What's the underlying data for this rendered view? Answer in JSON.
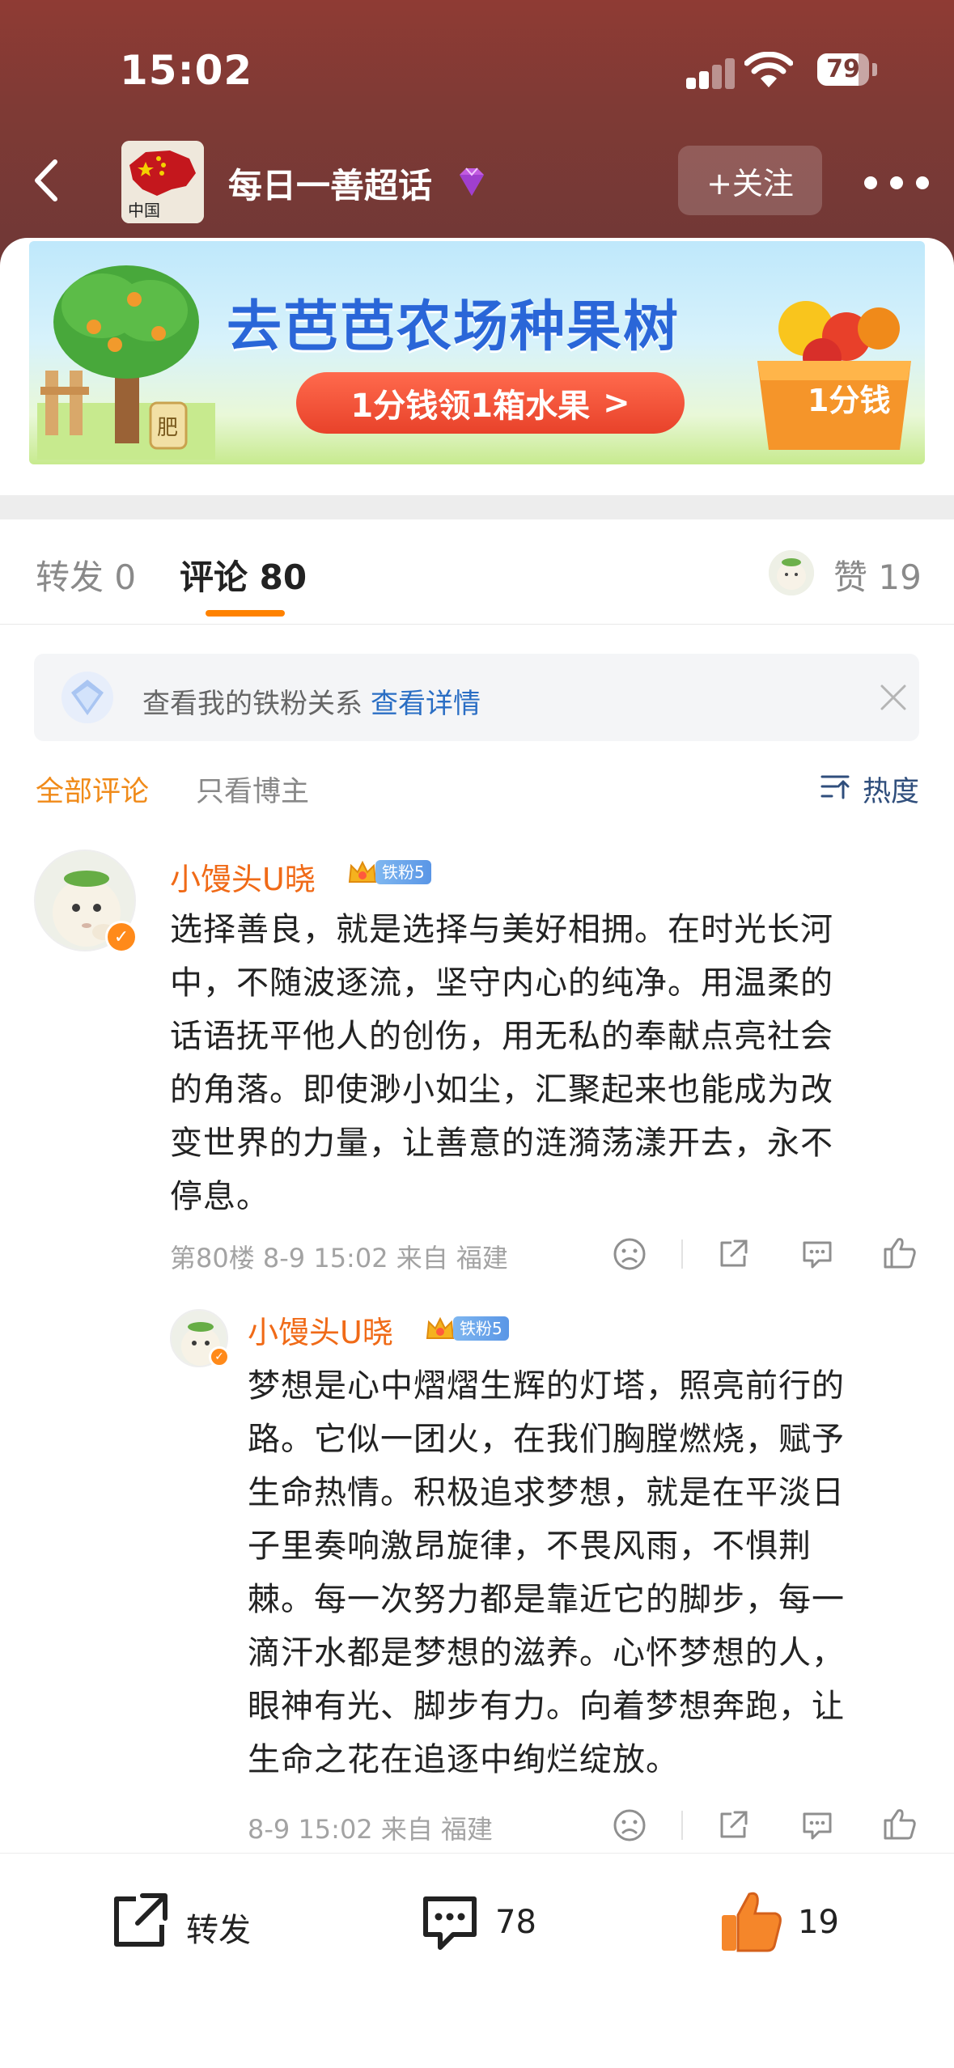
{
  "status_bar": {
    "time": "15:02",
    "battery": "79",
    "battery_fraction": 0.79
  },
  "header": {
    "topic_title": "每日一善超话",
    "follow_label": "+关注",
    "thumb_text": "中国"
  },
  "banner": {
    "title": "去芭芭农场种果树",
    "pill_label": "1分钱领1箱水果",
    "pill_arrow": ">",
    "basket_label": "1分钱",
    "tree_tag": "肥"
  },
  "tabs": {
    "forward": "转发 0",
    "comments": "评论 80",
    "likes": "赞 19"
  },
  "notice": {
    "text": "查看我的铁粉关系",
    "link": "查看详情"
  },
  "filter": {
    "all": "全部评论",
    "author_only": "只看博主",
    "sort": "热度"
  },
  "comments": [
    {
      "username": "小馒头U晓",
      "fan_level": "铁粉5",
      "lines": [
        "选择善良，就是选择与美好相拥。在时光长河",
        "中，不随波逐流，坚守内心的纯净。用温柔的",
        "话语抚平他人的创伤，用无私的奉献点亮社会",
        "的角落。即使渺小如尘，汇聚起来也能成为改",
        "变世界的力量，让善意的涟漪荡漾开去，永不",
        "停息。"
      ],
      "meta": "第80楼 8-9 15:02 来自 福建"
    },
    {
      "username": "小馒头U晓",
      "fan_level": "铁粉5",
      "lines": [
        "梦想是心中熠熠生辉的灯塔，照亮前行的",
        "路。它似一团火，在我们胸膛燃烧，赋予",
        "生命热情。积极追求梦想，就是在平淡日",
        "子里奏响激昂旋律，不畏风雨，不惧荆",
        "棘。每一次努力都是靠近它的脚步，每一",
        "滴汗水都是梦想的滋养。心怀梦想的人，",
        "眼神有光、脚步有力。向着梦想奔跑，让",
        "生命之花在追逐中绚烂绽放。"
      ],
      "meta": "8-9 15:02 来自 福建"
    }
  ],
  "bottom_bar": {
    "forward": "转发",
    "comment_count": "78",
    "like_count": "19"
  },
  "colors": {
    "accent_orange": "#ff8200",
    "username": "#f06a17",
    "link_blue": "#2a6ec4",
    "header_bg": "#8f3b34"
  }
}
